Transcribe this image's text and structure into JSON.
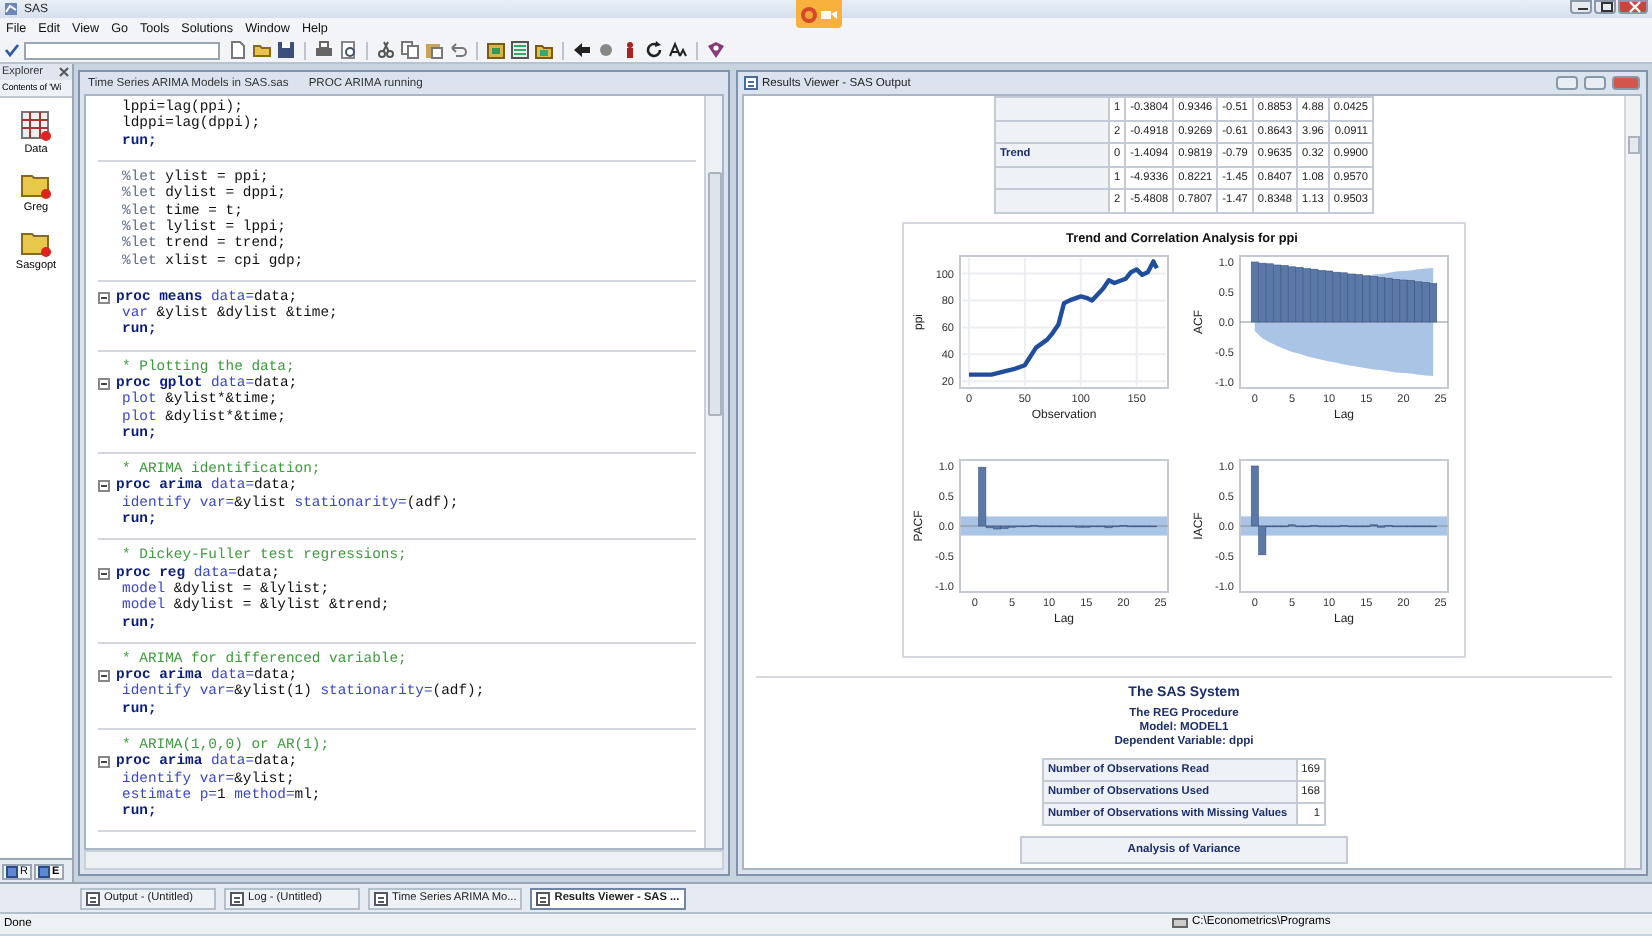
{
  "app": {
    "title": "SAS",
    "menu": [
      "File",
      "Edit",
      "View",
      "Go",
      "Tools",
      "Solutions",
      "Window",
      "Help"
    ]
  },
  "explorer": {
    "title": "Explorer",
    "subtitle": "Contents of 'Wi",
    "items": [
      {
        "label": "Data",
        "kind": "library"
      },
      {
        "label": "Greg",
        "kind": "folder"
      },
      {
        "label": "Sasgopt",
        "kind": "folder"
      }
    ],
    "tabs": [
      {
        "label": "R",
        "selected": false
      },
      {
        "label": "E",
        "selected": true
      }
    ]
  },
  "editor": {
    "title": "Time Series ARIMA Models in SAS.sas",
    "status": "PROC ARIMA running",
    "blocks": [
      {
        "lines": [
          {
            "fold": false,
            "parts": [
              {
                "kind": "plain",
                "text": "lppi=lag(ppi);"
              }
            ]
          },
          {
            "fold": false,
            "parts": [
              {
                "kind": "plain",
                "text": "ldppi=lag(dppi);"
              }
            ]
          },
          {
            "fold": false,
            "parts": [
              {
                "kind": "kw",
                "text": "run;"
              }
            ]
          }
        ]
      },
      {
        "lines": [
          {
            "fold": false,
            "parts": [
              {
                "kind": "macro",
                "text": "%let"
              },
              {
                "kind": "plain",
                "text": " ylist = ppi;"
              }
            ]
          },
          {
            "fold": false,
            "parts": [
              {
                "kind": "macro",
                "text": "%let"
              },
              {
                "kind": "plain",
                "text": " dylist = dppi;"
              }
            ]
          },
          {
            "fold": false,
            "parts": [
              {
                "kind": "macro",
                "text": "%let"
              },
              {
                "kind": "plain",
                "text": " time = t;"
              }
            ]
          },
          {
            "fold": false,
            "parts": [
              {
                "kind": "macro",
                "text": "%let"
              },
              {
                "kind": "plain",
                "text": " lylist = lppi;"
              }
            ]
          },
          {
            "fold": false,
            "parts": [
              {
                "kind": "macro",
                "text": "%let"
              },
              {
                "kind": "plain",
                "text": " trend = trend;"
              }
            ]
          },
          {
            "fold": false,
            "parts": [
              {
                "kind": "macro",
                "text": "%let"
              },
              {
                "kind": "plain",
                "text": " xlist = cpi gdp;"
              }
            ]
          }
        ]
      },
      {
        "lines": [
          {
            "fold": true,
            "parts": [
              {
                "kind": "kw",
                "text": "proc means"
              },
              {
                "kind": "opt",
                "text": " data="
              },
              {
                "kind": "plain",
                "text": "data;"
              }
            ]
          },
          {
            "fold": false,
            "parts": [
              {
                "kind": "opt",
                "text": "var"
              },
              {
                "kind": "plain",
                "text": " &ylist &dylist &time;"
              }
            ]
          },
          {
            "fold": false,
            "parts": [
              {
                "kind": "kw",
                "text": "run;"
              }
            ]
          }
        ]
      },
      {
        "lines": [
          {
            "fold": false,
            "parts": [
              {
                "kind": "cmt",
                "text": "* Plotting the data;"
              }
            ]
          },
          {
            "fold": true,
            "parts": [
              {
                "kind": "kw",
                "text": "proc gplot"
              },
              {
                "kind": "opt",
                "text": " data="
              },
              {
                "kind": "plain",
                "text": "data;"
              }
            ]
          },
          {
            "fold": false,
            "parts": [
              {
                "kind": "opt",
                "text": "plot"
              },
              {
                "kind": "plain",
                "text": " &ylist*&time;"
              }
            ]
          },
          {
            "fold": false,
            "parts": [
              {
                "kind": "opt",
                "text": "plot"
              },
              {
                "kind": "plain",
                "text": " &dylist*&time;"
              }
            ]
          },
          {
            "fold": false,
            "parts": [
              {
                "kind": "kw",
                "text": "run;"
              }
            ]
          }
        ]
      },
      {
        "lines": [
          {
            "fold": false,
            "parts": [
              {
                "kind": "cmt",
                "text": "* ARIMA identification;"
              }
            ]
          },
          {
            "fold": true,
            "parts": [
              {
                "kind": "kw",
                "text": "proc arima"
              },
              {
                "kind": "opt",
                "text": " data="
              },
              {
                "kind": "plain",
                "text": "data;"
              }
            ]
          },
          {
            "fold": false,
            "parts": [
              {
                "kind": "opt",
                "text": "identify var="
              },
              {
                "kind": "plain",
                "text": "&ylist "
              },
              {
                "kind": "opt",
                "text": "stationarity="
              },
              {
                "kind": "plain",
                "text": "(adf);"
              }
            ]
          },
          {
            "fold": false,
            "parts": [
              {
                "kind": "kw",
                "text": "run;"
              }
            ]
          }
        ]
      },
      {
        "lines": [
          {
            "fold": false,
            "parts": [
              {
                "kind": "cmt",
                "text": "* Dickey-Fuller test regressions;"
              }
            ]
          },
          {
            "fold": true,
            "parts": [
              {
                "kind": "kw",
                "text": "proc reg"
              },
              {
                "kind": "opt",
                "text": " data="
              },
              {
                "kind": "plain",
                "text": "data;"
              }
            ]
          },
          {
            "fold": false,
            "parts": [
              {
                "kind": "opt",
                "text": "model"
              },
              {
                "kind": "plain",
                "text": " &dylist = &lylist;"
              }
            ]
          },
          {
            "fold": false,
            "parts": [
              {
                "kind": "opt",
                "text": "model"
              },
              {
                "kind": "plain",
                "text": " &dylist = &lylist &trend;"
              }
            ]
          },
          {
            "fold": false,
            "parts": [
              {
                "kind": "kw",
                "text": "run;"
              }
            ]
          }
        ]
      },
      {
        "lines": [
          {
            "fold": false,
            "parts": [
              {
                "kind": "cmt",
                "text": "* ARIMA for differenced variable;"
              }
            ]
          },
          {
            "fold": true,
            "parts": [
              {
                "kind": "kw",
                "text": "proc arima"
              },
              {
                "kind": "opt",
                "text": " data="
              },
              {
                "kind": "plain",
                "text": "data;"
              }
            ]
          },
          {
            "fold": false,
            "parts": [
              {
                "kind": "opt",
                "text": "identify var="
              },
              {
                "kind": "plain",
                "text": "&ylist(1) "
              },
              {
                "kind": "opt",
                "text": "stationarity="
              },
              {
                "kind": "plain",
                "text": "(adf);"
              }
            ]
          },
          {
            "fold": false,
            "parts": [
              {
                "kind": "kw",
                "text": "run;"
              }
            ]
          }
        ]
      },
      {
        "lines": [
          {
            "fold": false,
            "parts": [
              {
                "kind": "cmt",
                "text": "* ARIMA(1,0,0) or AR(1);"
              }
            ]
          },
          {
            "fold": true,
            "parts": [
              {
                "kind": "kw",
                "text": "proc arima"
              },
              {
                "kind": "opt",
                "text": " data="
              },
              {
                "kind": "plain",
                "text": "data;"
              }
            ]
          },
          {
            "fold": false,
            "parts": [
              {
                "kind": "opt",
                "text": "identify var="
              },
              {
                "kind": "plain",
                "text": "&ylist;"
              }
            ]
          },
          {
            "fold": false,
            "parts": [
              {
                "kind": "opt",
                "text": "estimate p="
              },
              {
                "kind": "plain",
                "text": "1 "
              },
              {
                "kind": "opt",
                "text": "method="
              },
              {
                "kind": "plain",
                "text": "ml;"
              }
            ]
          },
          {
            "fold": false,
            "parts": [
              {
                "kind": "kw",
                "text": "run;"
              }
            ]
          }
        ]
      }
    ]
  },
  "results": {
    "title": "Results Viewer - SAS Output",
    "table": {
      "rows": [
        {
          "cells": [
            "1",
            "-0.3804",
            "0.9346",
            "-0.51",
            "0.8853",
            "4.88",
            "0.0425"
          ]
        },
        {
          "cells": [
            "2",
            "-0.4918",
            "0.9269",
            "-0.61",
            "0.8643",
            "3.96",
            "0.0911"
          ]
        },
        {
          "label": "Trend",
          "cells": [
            "0",
            "-1.4094",
            "0.9819",
            "-0.79",
            "0.9635",
            "0.32",
            "0.9900"
          ]
        },
        {
          "cells": [
            "1",
            "-4.9336",
            "0.8221",
            "-1.45",
            "0.8407",
            "1.08",
            "0.9570"
          ]
        },
        {
          "cells": [
            "2",
            "-5.4808",
            "0.7807",
            "-1.47",
            "0.8348",
            "1.13",
            "0.9503"
          ]
        }
      ]
    },
    "diagnostics": {
      "title": "Trend and Correlation Analysis for ppi",
      "charts": [
        {
          "chart_data": {
            "type": "line",
            "grid": true,
            "xlabel": "Observation",
            "ylabel": "ppi",
            "xlim": [
              -8,
              178
            ],
            "ylim": [
              15,
              113
            ],
            "xticks": [
              0,
              50,
              100,
              150
            ],
            "yticks": [
              20,
              40,
              60,
              80,
              100
            ],
            "x": [
              0,
              10,
              20,
              30,
              40,
              50,
              60,
              65,
              70,
              75,
              80,
              85,
              90,
              100,
              105,
              110,
              120,
              125,
              130,
              140,
              145,
              150,
              155,
              160,
              165,
              168
            ],
            "series": [
              {
                "color": "#1f4e9c",
                "values": [
                  25,
                  25,
                  25,
                  27,
                  29,
                  32,
                  45,
                  48,
                  51,
                  56,
                  62,
                  78,
                  80,
                  83,
                  82,
                  80,
                  89,
                  95,
                  93,
                  96,
                  101,
                  103,
                  99,
                  101,
                  109,
                  104
                ]
              }
            ]
          }
        },
        {
          "chart_data": {
            "type": "bar",
            "xlabel": "Lag",
            "ylabel": "ACF",
            "xlim": [
              -2,
              26
            ],
            "ylim": [
              -1.1,
              1.1
            ],
            "xticks": [
              0,
              5,
              10,
              15,
              20,
              25
            ],
            "yticks": [
              {
                "value": -1,
                "label": "-1.0"
              },
              {
                "value": -0.5,
                "label": "-0.5"
              },
              {
                "value": 0,
                "label": "0.0"
              },
              {
                "value": 0.5,
                "label": "0.5"
              },
              {
                "value": 1,
                "label": "1.0"
              }
            ],
            "x": [
              0,
              1,
              2,
              3,
              4,
              5,
              6,
              7,
              8,
              9,
              10,
              11,
              12,
              13,
              14,
              15,
              16,
              17,
              18,
              19,
              20,
              21,
              22,
              23,
              24
            ],
            "series": [
              {
                "type": "bar",
                "color": "#5b79a8",
                "values": [
                  1.0,
                  0.98,
                  0.97,
                  0.95,
                  0.94,
                  0.92,
                  0.91,
                  0.89,
                  0.88,
                  0.86,
                  0.85,
                  0.83,
                  0.82,
                  0.8,
                  0.79,
                  0.77,
                  0.76,
                  0.74,
                  0.73,
                  0.71,
                  0.7,
                  0.69,
                  0.67,
                  0.66,
                  0.64
                ]
              },
              {
                "type": "area",
                "color": "#aac4e6",
                "values": [
                  null,
                  null,
                  null,
                  null,
                  null,
                  null,
                  null,
                  null,
                  null,
                  null,
                  null,
                  null,
                  null,
                  null,
                  0.75,
                  0.77,
                  0.79,
                  0.8,
                  0.82,
                  0.84,
                  0.85,
                  0.86,
                  0.88,
                  0.89,
                  0.9
                ]
              },
              {
                "type": "area",
                "color": "#aac4e6",
                "values": [
                  -0.15,
                  -0.27,
                  -0.34,
                  -0.4,
                  -0.45,
                  -0.5,
                  -0.53,
                  -0.57,
                  -0.6,
                  -0.63,
                  -0.66,
                  -0.68,
                  -0.71,
                  -0.73,
                  -0.75,
                  -0.77,
                  -0.79,
                  -0.8,
                  -0.82,
                  -0.84,
                  -0.85,
                  -0.86,
                  -0.88,
                  -0.89,
                  -0.9
                ]
              }
            ]
          }
        },
        {
          "chart_data": {
            "type": "bar",
            "xlabel": "Lag",
            "ylabel": "PACF",
            "xlim": [
              -2,
              26
            ],
            "ylim": [
              -1.1,
              1.1
            ],
            "xticks": [
              0,
              5,
              10,
              15,
              20,
              25
            ],
            "yticks": [
              {
                "value": -1,
                "label": "-1.0"
              },
              {
                "value": -0.5,
                "label": "-0.5"
              },
              {
                "value": 0,
                "label": "0.0"
              },
              {
                "value": 0.5,
                "label": "0.5"
              },
              {
                "value": 1,
                "label": "1.0"
              }
            ],
            "x": [
              1,
              2,
              3,
              4,
              5,
              6,
              7,
              8,
              9,
              10,
              11,
              12,
              13,
              14,
              15,
              16,
              17,
              18,
              19,
              20,
              21,
              22,
              23,
              24
            ],
            "series": [
              {
                "color": "#5b79a8",
                "values": [
                  0.98,
                  -0.03,
                  -0.05,
                  -0.04,
                  -0.02,
                  -0.01,
                  0,
                  0.01,
                  0,
                  0,
                  -0.01,
                  0,
                  0,
                  -0.02,
                  -0.02,
                  -0.01,
                  0,
                  -0.03,
                  0,
                  0.01,
                  -0.01,
                  0,
                  0,
                  0
                ]
              }
            ],
            "bands": [
              {
                "axis": "y",
                "from": -0.16,
                "to": 0.16
              }
            ]
          }
        },
        {
          "chart_data": {
            "type": "bar",
            "xlabel": "Lag",
            "ylabel": "IACF",
            "xlim": [
              -2,
              26
            ],
            "ylim": [
              -1.1,
              1.1
            ],
            "xticks": [
              0,
              5,
              10,
              15,
              20,
              25
            ],
            "yticks": [
              {
                "value": -1,
                "label": "-1.0"
              },
              {
                "value": -0.5,
                "label": "-0.5"
              },
              {
                "value": 0,
                "label": "0.0"
              },
              {
                "value": 0.5,
                "label": "0.5"
              },
              {
                "value": 1,
                "label": "1.0"
              }
            ],
            "x": [
              0,
              1,
              2,
              3,
              4,
              5,
              6,
              7,
              8,
              9,
              10,
              11,
              12,
              13,
              14,
              15,
              16,
              17,
              18,
              19,
              20,
              21,
              22,
              23,
              24
            ],
            "series": [
              {
                "color": "#5b79a8",
                "values": [
                  1.0,
                  -0.48,
                  0,
                  0,
                  0,
                  0.02,
                  0,
                  0,
                  0.01,
                  0,
                  0,
                  0,
                  0.01,
                  0,
                  0,
                  0,
                  0.02,
                  -0.02,
                  0.01,
                  0,
                  0,
                  0,
                  0,
                  0,
                  0
                ]
              }
            ],
            "bands": [
              {
                "axis": "y",
                "from": -0.16,
                "to": 0.16
              }
            ]
          }
        }
      ]
    },
    "report": {
      "title": "The SAS System",
      "subtitles": [
        "The REG Procedure",
        "Model: MODEL1",
        "Dependent Variable: dppi"
      ],
      "observations": [
        {
          "label": "Number of Observations Read",
          "value": "169"
        },
        {
          "label": "Number of Observations Used",
          "value": "168"
        },
        {
          "label": "Number of Observations with Missing Values",
          "value": "1"
        }
      ],
      "next_table": "Analysis of Variance"
    }
  },
  "taskbar": [
    {
      "label": "Output - (Untitled)",
      "selected": false
    },
    {
      "label": "Log - (Untitled)",
      "selected": false
    },
    {
      "label": "Time Series ARIMA Mo...",
      "selected": false
    },
    {
      "label": "Results Viewer - SAS ...",
      "selected": true
    }
  ],
  "status_bar": {
    "message": "Done",
    "path": "C:\\Econometrics\\Programs"
  }
}
